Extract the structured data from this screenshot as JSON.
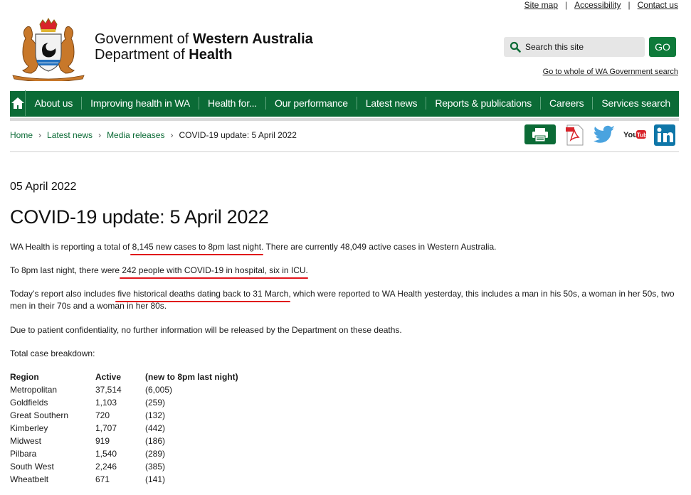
{
  "utility_links": [
    "Site map",
    "Accessibility",
    "Contact us"
  ],
  "org": {
    "line1_prefix": "Government of ",
    "line1_bold": "Western Australia",
    "line2_prefix": "Department of ",
    "line2_bold": "Health"
  },
  "search": {
    "placeholder": "Search this site",
    "button_label": "GO",
    "wa_link": "Go to whole of WA Government search"
  },
  "nav": {
    "home_icon": "home-icon",
    "items": [
      "About us",
      "Improving health in WA",
      "Health for...",
      "Our performance",
      "Latest news",
      "Reports & publications",
      "Careers",
      "Services search"
    ]
  },
  "breadcrumb": [
    "Home",
    "Latest news",
    "Media releases",
    "COVID-19 update: 5 April 2022"
  ],
  "share_icons": [
    "print-icon",
    "pdf-icon",
    "twitter-icon",
    "youtube-icon",
    "linkedin-icon"
  ],
  "colors": {
    "brand_green": "#0b6b36",
    "go_green": "#0e7a3a",
    "annotation_red": "#e0141b"
  },
  "article": {
    "date": "05 April 2022",
    "title": "COVID-19 update: 5 April 2022",
    "p1": {
      "a": "WA Health is reporting a total of ",
      "b": "8,145 new cases to 8pm last night",
      "c": ". There are currently 48,049 active cases in Western Australia."
    },
    "p2": {
      "a": "To 8pm last night, there were ",
      "b": "242 people with COVID-19 in hospital, six in ICU",
      "c": "."
    },
    "p3": {
      "a": "Today’s report also includes ",
      "b": "five historical deaths dating back to 31 March",
      "c": ", which were reported to WA Health yesterday, this includes a man in his 50s, a woman in her 50s, two",
      "d": "men in their 70s and a woman in her 80s."
    },
    "p4": "Due to patient confidentiality, no further information will be released by the Department on these deaths.",
    "p5": "Total case breakdown:",
    "table": {
      "headers": [
        "Region",
        "Active",
        "(new to 8pm last night)"
      ],
      "rows": [
        [
          "Metropolitan",
          "37,514",
          "(6,005)"
        ],
        [
          "Goldfields",
          "1,103",
          "(259)"
        ],
        [
          "Great Southern",
          "720",
          "(132)"
        ],
        [
          "Kimberley",
          "1,707",
          "(442)"
        ],
        [
          "Midwest",
          "919",
          "(186)"
        ],
        [
          "Pilbara",
          "1,540",
          "(289)"
        ],
        [
          "South West",
          "2,246",
          "(385)"
        ],
        [
          "Wheatbelt",
          "671",
          "(141)"
        ]
      ]
    }
  }
}
